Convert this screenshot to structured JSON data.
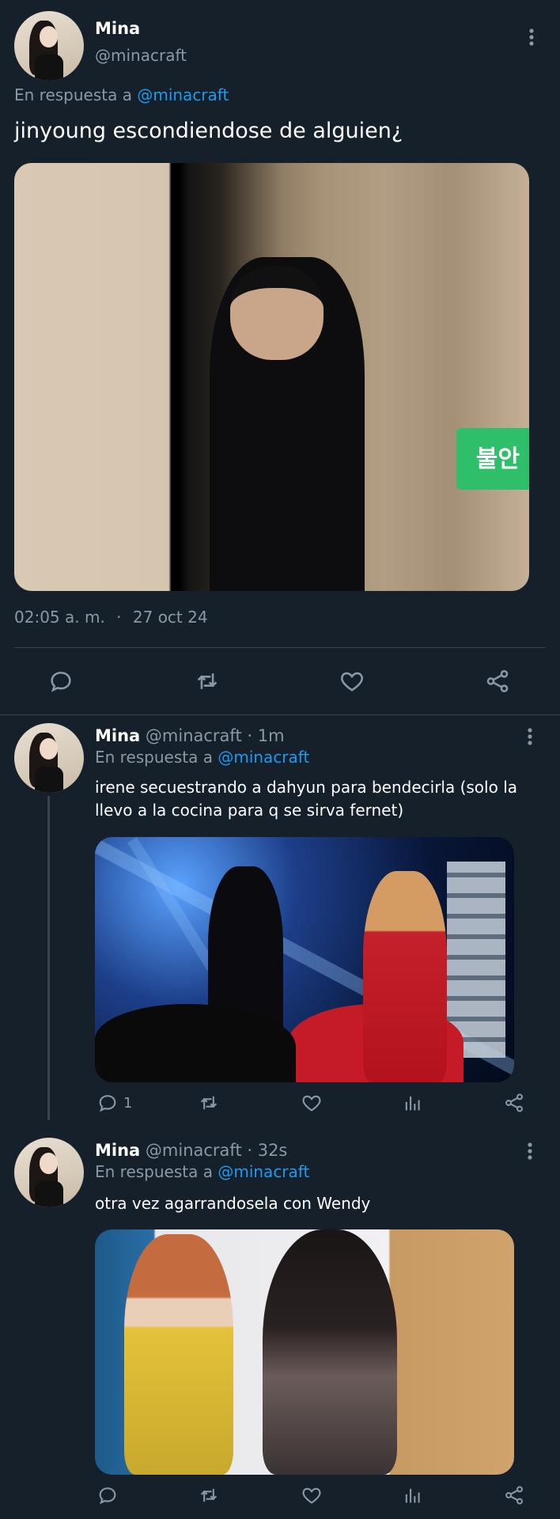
{
  "main_tweet": {
    "author_name": "Mina",
    "author_handle": "@minacraft",
    "reply_prefix": "En respuesta a",
    "reply_to": "@minacraft",
    "text": "jinyoung escondiendose de alguien¿",
    "image_text": "불안",
    "time": "02:05 a. m.",
    "dot": "·",
    "date": "27 oct 24"
  },
  "replies": [
    {
      "author_name": "Mina",
      "handle_time": "@minacraft · 1m",
      "reply_prefix": "En respuesta a",
      "reply_to": "@minacraft",
      "text": "irene secuestrando a dahyun para bendecirla (solo la llevo a la cocina para q se sirva fernet)",
      "reply_count": "1"
    },
    {
      "author_name": "Mina",
      "handle_time": "@minacraft · 32s",
      "reply_prefix": "En respuesta a",
      "reply_to": "@minacraft",
      "text": "otra vez agarrandosela con Wendy",
      "reply_count": ""
    }
  ],
  "colors": {
    "background": "#15202b",
    "text": "#ffffff",
    "muted": "#8b98a5",
    "link": "#1d9bf0",
    "divider": "#38444d"
  },
  "icons": [
    "more-icon",
    "reply-icon",
    "retweet-icon",
    "like-icon",
    "share-icon",
    "views-icon"
  ]
}
